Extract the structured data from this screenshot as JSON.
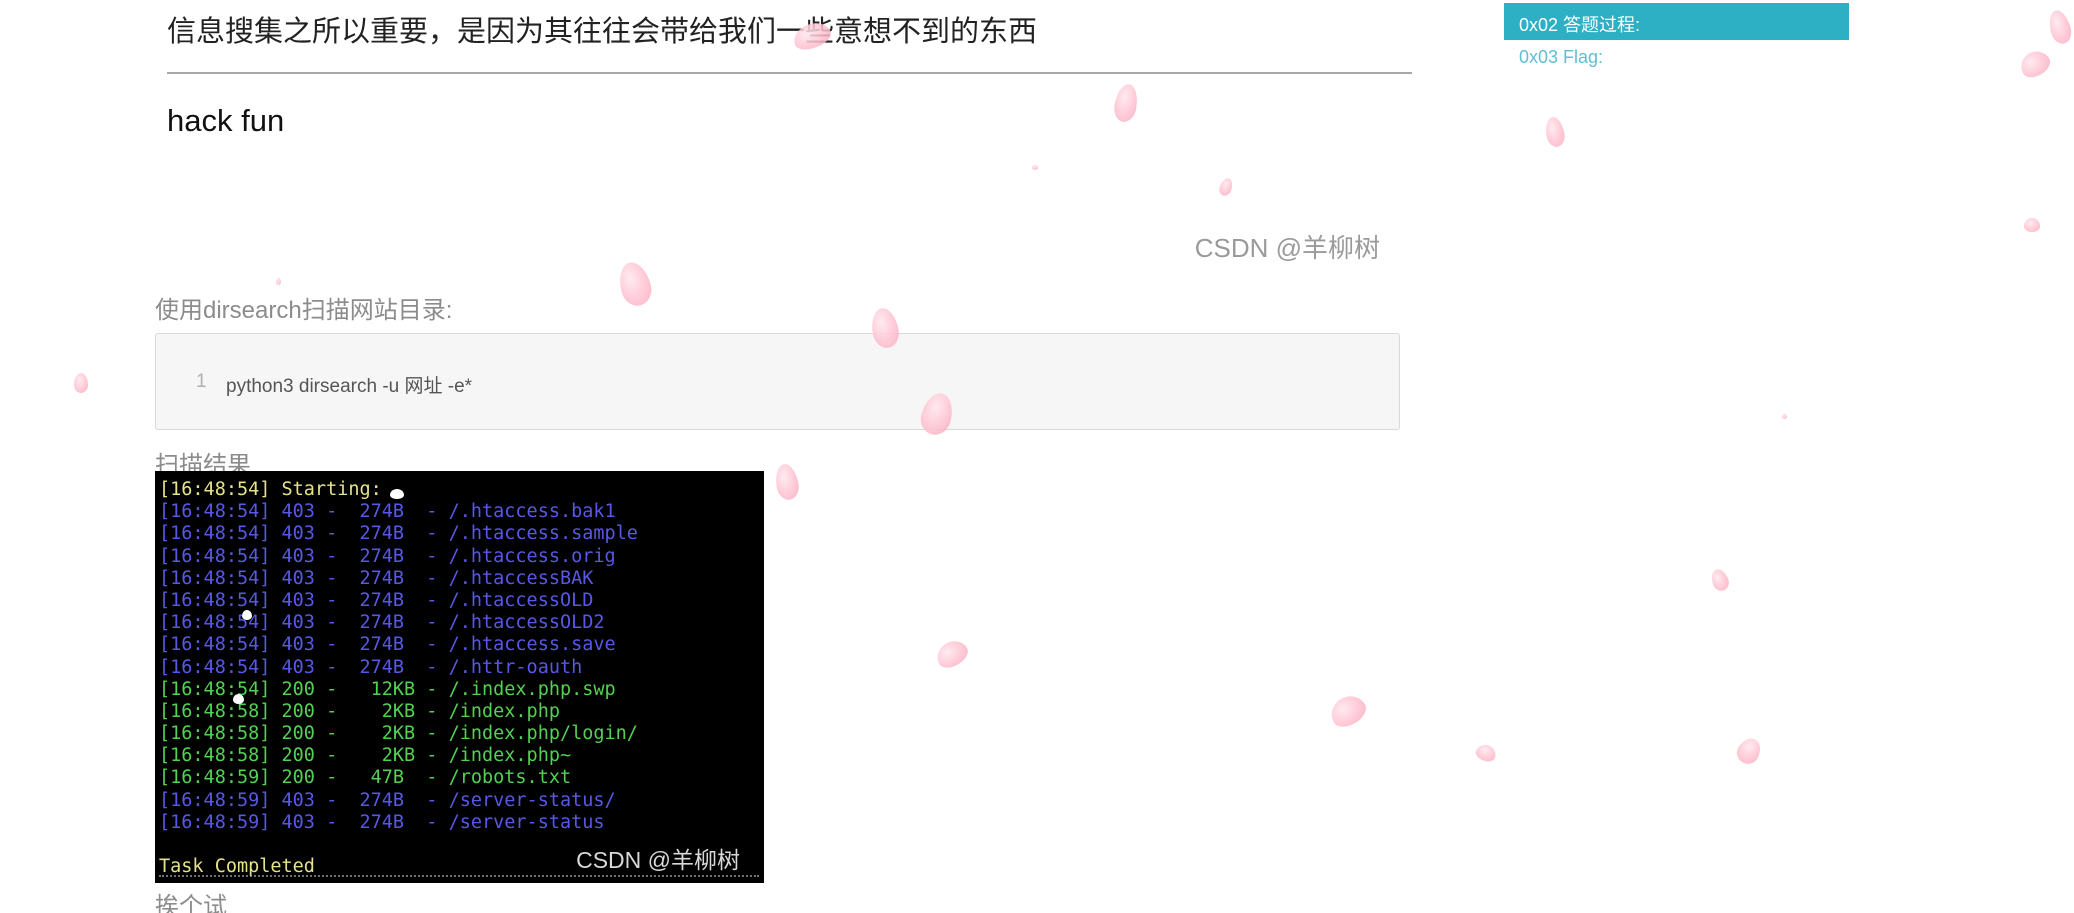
{
  "article": {
    "screenshot_title": "信息搜集之所以重要，是因为其往往会带给我们一些意想不到的东西",
    "screenshot_subtitle": "hack fun",
    "watermark": "CSDN @羊柳树",
    "intro": "使用dirsearch扫描网站目录:",
    "code": {
      "line_number": "1",
      "command": "python3 dirsearch -u 网址 -e*"
    },
    "result_label": "扫描结果",
    "next_label": "挨个试"
  },
  "terminal": {
    "lines": [
      {
        "text": "[16:48:54] Starting:",
        "kind": "start"
      },
      {
        "text": "[16:48:54] 403 -  274B  - /.htaccess.bak1",
        "kind": "s403"
      },
      {
        "text": "[16:48:54] 403 -  274B  - /.htaccess.sample",
        "kind": "s403"
      },
      {
        "text": "[16:48:54] 403 -  274B  - /.htaccess.orig",
        "kind": "s403"
      },
      {
        "text": "[16:48:54] 403 -  274B  - /.htaccessBAK",
        "kind": "s403"
      },
      {
        "text": "[16:48:54] 403 -  274B  - /.htaccessOLD",
        "kind": "s403"
      },
      {
        "text": "[16:48:54] 403 -  274B  - /.htaccessOLD2",
        "kind": "s403"
      },
      {
        "text": "[16:48:54] 403 -  274B  - /.htaccess.save",
        "kind": "s403"
      },
      {
        "text": "[16:48:54] 403 -  274B  - /.httr-oauth",
        "kind": "s403"
      },
      {
        "text": "[16:48:54] 200 -   12KB - /.index.php.swp",
        "kind": "s200"
      },
      {
        "text": "[16:48:58] 200 -    2KB - /index.php",
        "kind": "s200"
      },
      {
        "text": "[16:48:58] 200 -    2KB - /index.php/login/",
        "kind": "s200"
      },
      {
        "text": "[16:48:58] 200 -    2KB - /index.php~",
        "kind": "s200"
      },
      {
        "text": "[16:48:59] 200 -   47B  - /robots.txt",
        "kind": "s200"
      },
      {
        "text": "[16:48:59] 403 -  274B  - /server-status/",
        "kind": "s403"
      },
      {
        "text": "[16:48:59] 403 -  274B  - /server-status",
        "kind": "s403"
      }
    ],
    "completed": "Task Completed",
    "watermark": "CSDN @羊柳树"
  },
  "toc": {
    "active_item": "0x02 答题过程:",
    "item": "0x03 Flag:"
  },
  "colors": {
    "toc_active_bg": "#2db0c4",
    "toc_link": "#5fbfd2",
    "term_403": "#5858e6",
    "term_200": "#52d152",
    "term_info": "#e6e28a"
  }
}
